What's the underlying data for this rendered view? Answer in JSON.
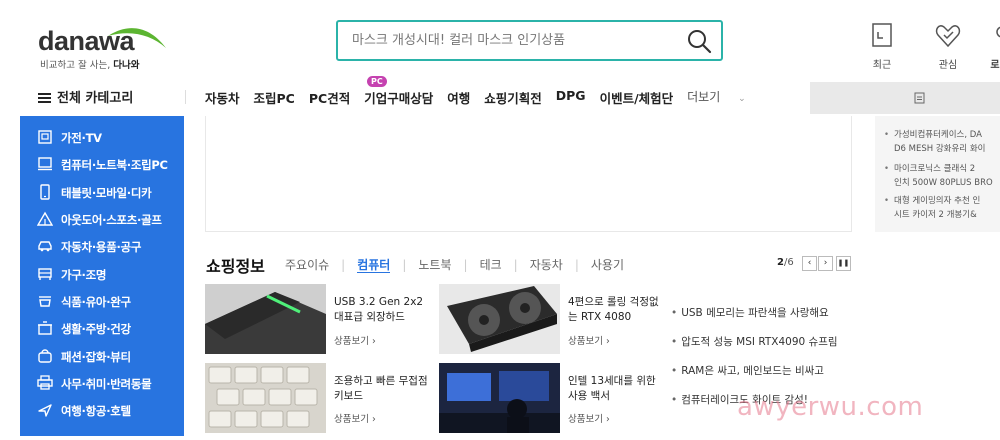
{
  "logo": {
    "wordmark": "danawa",
    "tagline_a": "비교하고 잘 사는, ",
    "tagline_b": "다나와"
  },
  "search": {
    "placeholder": "마스크 개성시대! 컬러 마스크 인기상품"
  },
  "header_icons": [
    {
      "label": "최근",
      "icon": "recent-icon"
    },
    {
      "label": "관심",
      "icon": "heart-icon"
    },
    {
      "label": "로",
      "icon": "user-icon"
    }
  ],
  "nav": {
    "all_categories": "전체 카테고리",
    "badge": "PC",
    "items": [
      "자동차",
      "조립PC",
      "PC견적",
      "기업구매상담",
      "여행",
      "쇼핑기획전",
      "DPG",
      "이벤트/체험단"
    ],
    "more": "더보기"
  },
  "sidebar": [
    {
      "label": "가전·TV",
      "icon": "tv-icon"
    },
    {
      "label": "컴퓨터·노트북·조립PC",
      "icon": "computer-icon"
    },
    {
      "label": "태블릿·모바일·디카",
      "icon": "tablet-icon"
    },
    {
      "label": "아웃도어·스포츠·골프",
      "icon": "tent-icon"
    },
    {
      "label": "자동차·용품·공구",
      "icon": "car-icon"
    },
    {
      "label": "가구·조명",
      "icon": "furniture-icon"
    },
    {
      "label": "식품·유아·완구",
      "icon": "food-icon"
    },
    {
      "label": "생활·주방·건강",
      "icon": "kitchen-icon"
    },
    {
      "label": "패션·잡화·뷰티",
      "icon": "fashion-icon"
    },
    {
      "label": "사무·취미·반려동물",
      "icon": "printer-icon"
    },
    {
      "label": "여행·항공·호텔",
      "icon": "plane-icon"
    }
  ],
  "right_panel": [
    {
      "line1": "가성비컴퓨터케이스, DA",
      "line2": "D6 MESH 강화유리 화이"
    },
    {
      "line1": "마이크로닉스 클래식 2",
      "line2": "인치 500W 80PLUS BRO"
    },
    {
      "line1": "대형 게이밍의자 추천 인",
      "line2": "시트 카이저 2 개봉기&"
    }
  ],
  "shopping": {
    "title": "쇼핑정보",
    "tabs": [
      "주요이슈",
      "컴퓨터",
      "노트북",
      "테크",
      "자동차",
      "사용기"
    ],
    "active_tab": "컴퓨터",
    "page_current": "2",
    "page_total": "/6",
    "cards": [
      {
        "title": "USB 3.2 Gen 2x2 대표급 외장하드",
        "link": "상품보기 ›"
      },
      {
        "title": "4편으로 롤링 걱정없는 RTX 4080",
        "link": "상품보기 ›"
      },
      {
        "title": "조용하고 빠른 무접점 키보드",
        "link": "상품보기 ›"
      },
      {
        "title": "인텔 13세대를 위한 사용 백서",
        "link": "상품보기 ›"
      }
    ],
    "news": [
      "USB 메모리는 파란색을 사랑해요",
      "압도적 성능 MSI RTX4090 슈프림",
      "RAM은 싸고, 메인보드는 비싸고",
      "컴퓨터레이크도 화이트 감성!"
    ]
  },
  "watermark": "awyerwu.com",
  "colors": {
    "sidebar": "#2874e0",
    "search_border": "#2bb3a9",
    "brand_green": "#5cb531",
    "badge": "#c542b0"
  }
}
